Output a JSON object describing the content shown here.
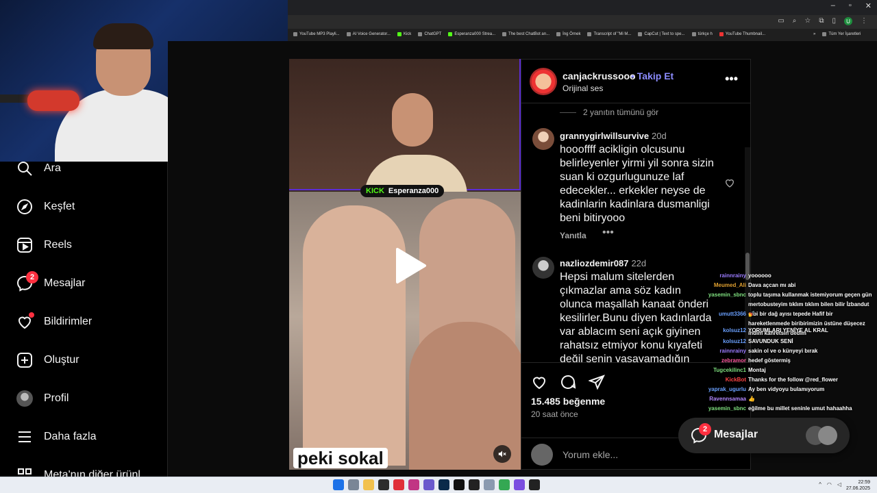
{
  "browser": {
    "bookmarks": [
      "YouTube MP3 Playli...",
      "AI Voice Generator...",
      "Kick",
      "ChatGPT",
      "Esperanza000 Strea...",
      "The best ChatBot an...",
      "İng Örnek",
      "Transcript of \"Mi M...",
      "CapCut | Text to spe...",
      "türkçe h",
      "YouTube Thumbnail..."
    ],
    "all_bookmarks": "Tüm Yer İşaretleri",
    "profile_letter": "U"
  },
  "sidebar": {
    "items": [
      {
        "label": "Ara",
        "icon": "search-icon"
      },
      {
        "label": "Keşfet",
        "icon": "compass-icon"
      },
      {
        "label": "Reels",
        "icon": "reels-icon"
      },
      {
        "label": "Mesajlar",
        "icon": "messenger-icon",
        "badge": "2"
      },
      {
        "label": "Bildirimler",
        "icon": "heart-icon",
        "dot": true
      },
      {
        "label": "Oluştur",
        "icon": "plus-square-icon"
      },
      {
        "label": "Profil",
        "icon": "avatar-icon"
      },
      {
        "label": "Daha fazla",
        "icon": "menu-icon"
      },
      {
        "label": "Meta'nın diğer ürünl",
        "icon": "meta-icon"
      }
    ]
  },
  "reel": {
    "stream_label_brand": "KICK",
    "stream_label_channel": "Esperanza000",
    "caption": "peki sokal"
  },
  "post": {
    "username": "canjackrussooo",
    "follow": "Takip Et",
    "audio": "Orijinal ses",
    "view_replies": "2 yanıtın tümünü gör",
    "comments": [
      {
        "user": "grannygirlwillsurvive",
        "time": "20d",
        "text": "hoooffff acikligin olcusunu belirleyenler yirmi yil sonra sizin suan ki ozgurlugunuze laf edecekler... erkekler neyse de kadinlarin kadinlara dusmanligi beni bitiryooo"
      },
      {
        "user": "nazliozdemir087",
        "time": "22d",
        "text": "Hepsi malum sitelerden çıkmazlar ama söz kadın olunca maşallah kanaat önderi kesilirler.Bunu diyen kadınlarda var ablacım seni açık giyinen rahatsız etmiyor konu kıyafeti değil senin yaşayamadığın"
      }
    ],
    "reply_label": "Yanıtla",
    "likes": "15.485 beğenme",
    "time_ago": "20 saat önce",
    "comment_placeholder": "Yorum ekle..."
  },
  "chat": [
    {
      "user": "rainnrainy",
      "color": "#9b7bff",
      "msg": "yoooooo"
    },
    {
      "user": "Meumed_Ali",
      "color": "#e0a030",
      "msg": "Dava açcan mı abi"
    },
    {
      "user": "yasemin_sbnc",
      "color": "#7fe07f",
      "msg": "toplu taşıma kullanmak istemiyorum geçen gün mertobusteyim tıklım tıklım bilen bilir İzbandut gibi bir dağ ayısı tepede Hafif bir hareketlenmede biribirimizin üstüne düşecez indim kahretsin dedim"
    },
    {
      "user": "umutt3366",
      "color": "#6aa0ff",
      "msg": "💅"
    },
    {
      "user": "kolsuz12",
      "color": "#6aa0ff",
      "msg": "YORUMLARI YENİYE AL KRAL"
    },
    {
      "user": "kolsuz12",
      "color": "#6aa0ff",
      "msg": "SAVUNDUK SENİ"
    },
    {
      "user": "rainnrainy",
      "color": "#9b7bff",
      "msg": "sakin ol ve o künyeyi bırak"
    },
    {
      "user": "zebramor",
      "color": "#ff5aa0",
      "msg": "hedef göstermiş"
    },
    {
      "user": "Tugcekilinc1",
      "color": "#7fe07f",
      "msg": "Montaj"
    },
    {
      "user": "KickBot",
      "color": "#ff4444",
      "msg": "Thanks for the follow @red_flower"
    },
    {
      "user": "yaprak_ugurlu",
      "color": "#6aa0ff",
      "msg": "Ay ben vidyoyu bulamıyorum"
    },
    {
      "user": "Ravennsamaa",
      "color": "#b388ff",
      "msg": "👍"
    },
    {
      "user": "yasemin_sbnc",
      "color": "#7fe07f",
      "msg": "eğilme bu millet seninle umut hahaahha"
    }
  ],
  "messages_pill": {
    "label": "Mesajlar",
    "badge": "2"
  },
  "taskbar": {
    "time": "22:59",
    "date": "27.06.2025"
  },
  "colors": {
    "accent": "#8c8cff",
    "badge": "#ff3040",
    "kick": "#53fc18",
    "stream_border": "#5b2bd6"
  }
}
